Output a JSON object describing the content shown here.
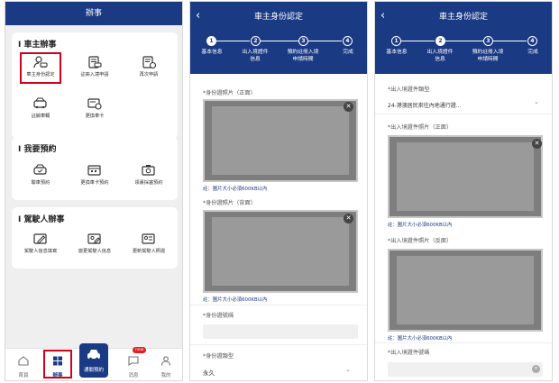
{
  "screen1": {
    "title": "辦事",
    "sections": [
      {
        "title": "車主辦事",
        "items": [
          {
            "label": "車主身份認定",
            "icon": "person-car-icon",
            "selected": true
          },
          {
            "label": "註冊入境申請",
            "icon": "document-car-icon"
          },
          {
            "label": "再次申請",
            "icon": "document-refresh-icon"
          },
          {
            "label": "註銷車輛",
            "icon": "car-delete-icon"
          },
          {
            "label": "更換車卡",
            "icon": "card-swap-icon"
          }
        ]
      },
      {
        "title": "我要預約",
        "items": [
          {
            "label": "驗車預約",
            "icon": "car-check-icon"
          },
          {
            "label": "更換車卡預約",
            "icon": "card-calendar-icon"
          },
          {
            "label": "領裏採塞預約",
            "icon": "camera-calendar-icon"
          }
        ]
      },
      {
        "title": "駕駛人辦事",
        "items": [
          {
            "label": "駕駛人信息填寫",
            "icon": "id-edit-icon"
          },
          {
            "label": "變更駕駛人信息",
            "icon": "id-user-edit-icon"
          },
          {
            "label": "更新駕駛人照證",
            "icon": "id-photo-icon"
          }
        ]
      }
    ],
    "tabbar": [
      {
        "label": "首頁",
        "icon": "home-icon"
      },
      {
        "label": "辦事",
        "icon": "grid-icon",
        "active": true
      },
      {
        "label": "通關預約",
        "icon": "car-icon",
        "center": true
      },
      {
        "label": "消息",
        "icon": "message-icon",
        "badge": "new"
      },
      {
        "label": "我的",
        "icon": "user-icon"
      }
    ]
  },
  "steps": [
    {
      "num": "1",
      "label": "基本信息"
    },
    {
      "num": "2",
      "label": "出入境證件\n信息"
    },
    {
      "num": "3",
      "label": "預約註冊入境\n申請時間"
    },
    {
      "num": "4",
      "label": "完成"
    }
  ],
  "screen2": {
    "title": "車主身份認定",
    "active_step": 1,
    "front_label": "*身份證照片（正面）",
    "back_label": "*身份證照片（背面）",
    "size_note": "註：圖片大小必須600KB以內",
    "id_number_label": "*身份證號碼",
    "id_type_label": "*身份證類型",
    "id_type_value": "永久"
  },
  "screen3": {
    "title": "車主身份認定",
    "active_step": 2,
    "doc_type_label": "*出入境證件類型",
    "doc_type_value": "24-港澳居民來往內地通行證...",
    "front_label": "*出入境證件照片（正面）",
    "back_label": "*出入境證件照片（反面）",
    "size_note": "註：圖片大小必須600KB以內",
    "doc_number_label": "*出入境證件號碼"
  },
  "colors": {
    "primary": "#1b3a84",
    "selection": "#d0021b",
    "badge": "#e02020"
  }
}
